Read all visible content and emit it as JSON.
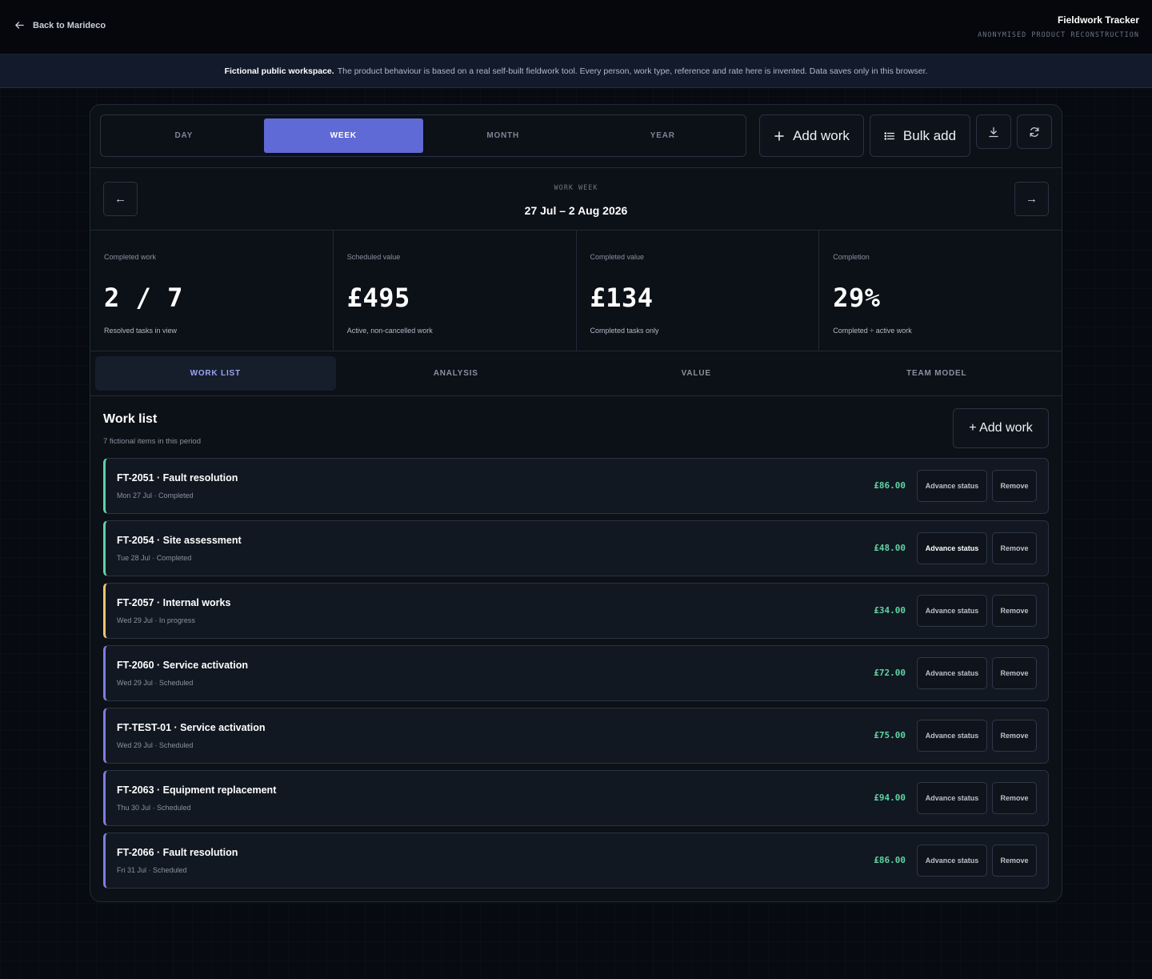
{
  "header": {
    "back_label": "Back to Marideco",
    "app_title": "Fieldwork Tracker",
    "app_subtitle": "ANONYMISED PRODUCT RECONSTRUCTION"
  },
  "notice": {
    "bold": "Fictional public workspace.",
    "text": "The product behaviour is based on a real self-built fieldwork tool. Every person, work type, reference and rate here is invented. Data saves only in this browser."
  },
  "toolbar": {
    "periods": [
      "DAY",
      "WEEK",
      "MONTH",
      "YEAR"
    ],
    "active_period": "WEEK",
    "add_work_label": "Add work",
    "bulk_add_label": "Bulk add",
    "download_icon": "download-icon",
    "refresh_icon": "refresh-icon"
  },
  "week_nav": {
    "prev": "←",
    "next": "→",
    "label": "WORK WEEK",
    "range": "27 Jul – 2 Aug 2026"
  },
  "stats": [
    {
      "label": "Completed work",
      "value": "2 / 7",
      "sub": "Resolved tasks in view"
    },
    {
      "label": "Scheduled value",
      "value": "£495",
      "sub": "Active, non-cancelled work"
    },
    {
      "label": "Completed value",
      "value": "£134",
      "sub": "Completed tasks only"
    },
    {
      "label": "Completion",
      "value": "29%",
      "sub": "Completed ÷ active work"
    }
  ],
  "subtabs": [
    "WORK LIST",
    "ANALYSIS",
    "VALUE",
    "TEAM MODEL"
  ],
  "active_subtab": "WORK LIST",
  "worklist": {
    "title": "Work list",
    "count": "7 fictional items in this period",
    "add_label": "+ Add work",
    "advance_label": "Advance status",
    "remove_label": "Remove",
    "items": [
      {
        "title": "FT-2051 · Fault resolution",
        "sub": "Mon 27 Jul · Completed",
        "amount": "£86.00",
        "status": "done"
      },
      {
        "title": "FT-2054 · Site assessment",
        "sub": "Tue 28 Jul · Completed",
        "amount": "£48.00",
        "status": "done"
      },
      {
        "title": "FT-2057 · Internal works",
        "sub": "Wed 29 Jul · In progress",
        "amount": "£34.00",
        "status": "progress"
      },
      {
        "title": "FT-2060 · Service activation",
        "sub": "Wed 29 Jul · Scheduled",
        "amount": "£72.00",
        "status": "sched"
      },
      {
        "title": "FT-TEST-01 · Service activation",
        "sub": "Wed 29 Jul · Scheduled",
        "amount": "£75.00",
        "status": "sched"
      },
      {
        "title": "FT-2063 · Equipment replacement",
        "sub": "Thu 30 Jul · Scheduled",
        "amount": "£94.00",
        "status": "sched"
      },
      {
        "title": "FT-2066 · Fault resolution",
        "sub": "Fri 31 Jul · Scheduled",
        "amount": "£86.00",
        "status": "sched"
      }
    ]
  },
  "colors": {
    "accent": "#5f6ad6",
    "completed": "#5fd3a4",
    "in_progress": "#f2c46d",
    "scheduled": "#7b7fe0",
    "amount": "#5fd3a4"
  }
}
